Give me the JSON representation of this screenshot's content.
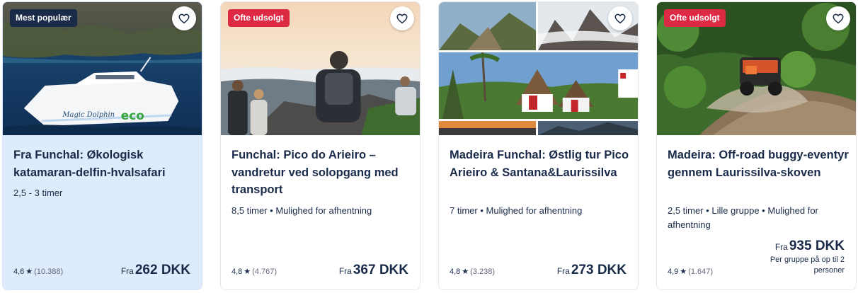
{
  "colors": {
    "navy": "#1a2b49",
    "badge_red": "#dc2a45",
    "highlight_card": "#ddebfc",
    "muted": "#63687a"
  },
  "cards": [
    {
      "badge": "Mest populær",
      "photo_text": "Magic Dolphin",
      "photo_logo": "eco",
      "title": "Fra Funchal: Økologisk katamaran-delfin-hvalsafari",
      "meta": "2,5 - 3 timer",
      "rating": "4,6",
      "reviews": "(10.388)",
      "price_prefix": "Fra",
      "price": "262 DKK",
      "wishlist_icon": "heart-icon"
    },
    {
      "badge": "Ofte udsolgt",
      "title": "Funchal: Pico do Arieiro – vandretur ved solopgang med transport",
      "meta": "8,5 timer • Mulighed for afhentning",
      "rating": "4,8",
      "reviews": "(4.767)",
      "price_prefix": "Fra",
      "price": "367 DKK",
      "wishlist_icon": "heart-icon"
    },
    {
      "title": "Madeira Funchal: Østlig tur Pico Arieiro & Santana&Laurissilva",
      "meta": "7 timer • Mulighed for afhentning",
      "rating": "4,8",
      "reviews": "(3.238)",
      "price_prefix": "Fra",
      "price": "273 DKK",
      "wishlist_icon": "heart-icon"
    },
    {
      "badge": "Ofte udsolgt",
      "title": "Madeira: Off-road buggy-eventyr gennem Laurissilva-skoven",
      "meta": "2,5 timer • Lille gruppe • Mulighed for afhentning",
      "rating": "4,9",
      "reviews": "(1.647)",
      "price_prefix": "Fra",
      "price": "935 DKK",
      "price_note": "Per gruppe på op til 2 personer",
      "wishlist_icon": "heart-icon"
    }
  ]
}
